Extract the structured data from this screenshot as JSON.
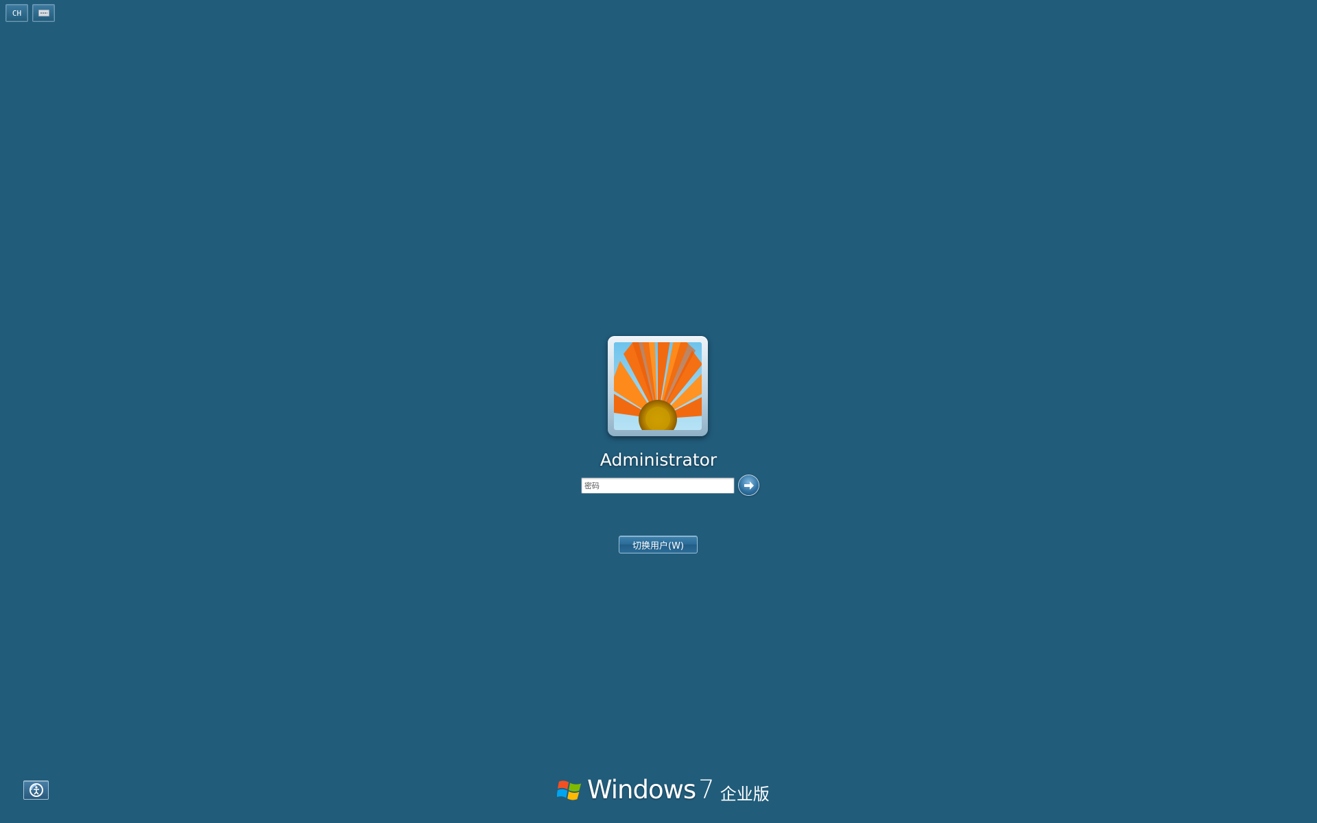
{
  "top_bar": {
    "language_label": "CH",
    "keyboard_icon": "keyboard-icon"
  },
  "login": {
    "username": "Administrator",
    "password_placeholder": "密码",
    "password_value": "",
    "submit_icon": "arrow-right-icon",
    "switch_user_label": "切换用户(W)"
  },
  "bottom": {
    "ease_of_access_icon": "ease-of-access-icon",
    "brand_word": "Windows",
    "brand_version": "7",
    "brand_edition": "企业版"
  },
  "colors": {
    "background": "#215c7b",
    "text": "#ffffff"
  }
}
